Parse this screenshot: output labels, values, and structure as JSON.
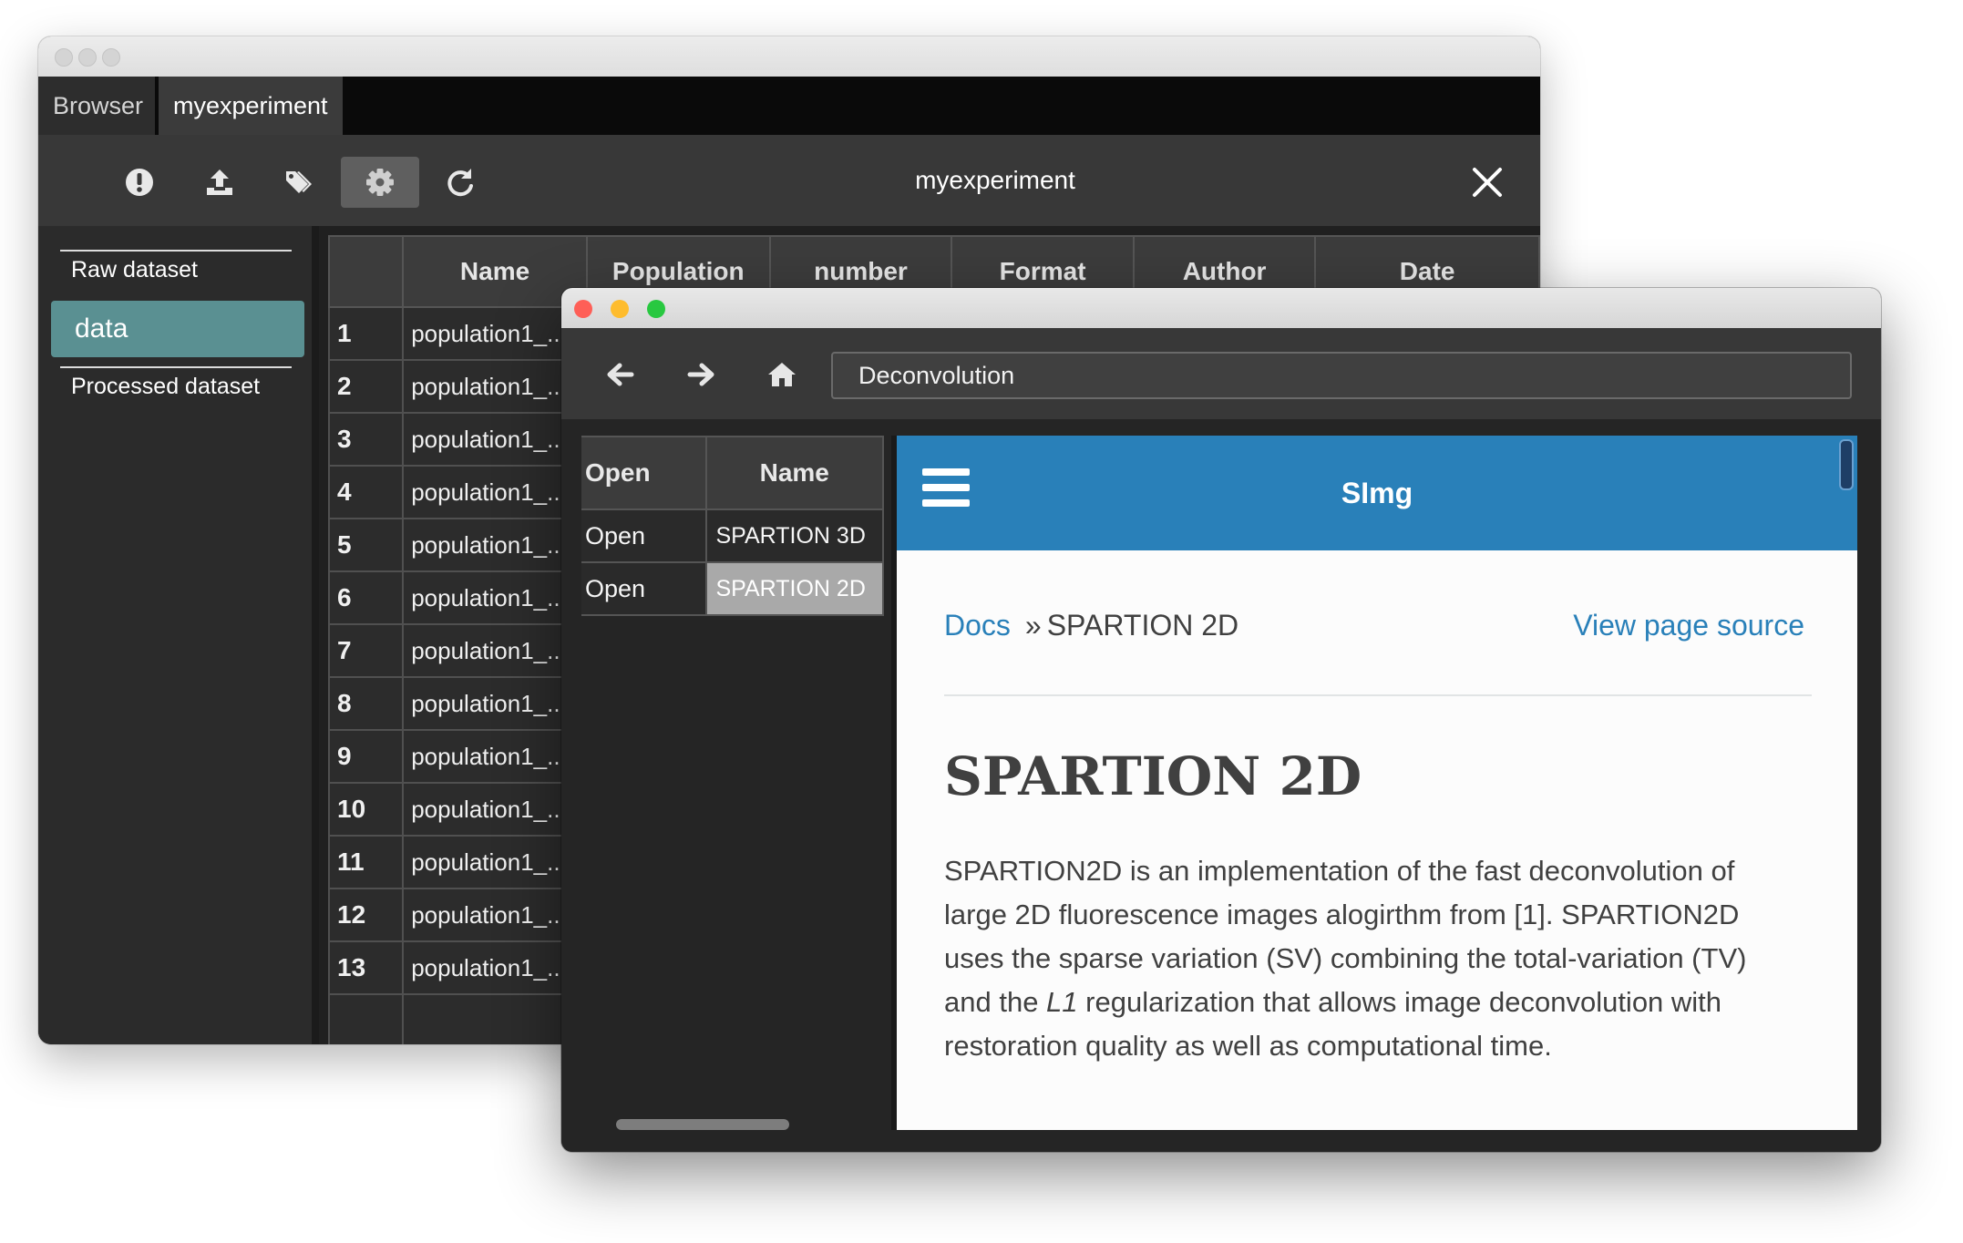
{
  "back_window": {
    "tabs": [
      "Browser",
      "myexperiment"
    ],
    "toolbar": {
      "title": "myexperiment",
      "icons": [
        "info-icon",
        "upload-icon",
        "tags-icon",
        "gear-icon",
        "refresh-icon",
        "close-icon"
      ]
    },
    "sidebar": {
      "raw_label": "Raw dataset",
      "selected_item": "data",
      "processed_label": "Processed dataset"
    },
    "table": {
      "columns": [
        "",
        "Name",
        "Population",
        "number",
        "Format",
        "Author",
        "Date"
      ],
      "rows": [
        {
          "idx": "1",
          "name": "population1_..."
        },
        {
          "idx": "2",
          "name": "population1_..."
        },
        {
          "idx": "3",
          "name": "population1_..."
        },
        {
          "idx": "4",
          "name": "population1_..."
        },
        {
          "idx": "5",
          "name": "population1_..."
        },
        {
          "idx": "6",
          "name": "population1_..."
        },
        {
          "idx": "7",
          "name": "population1_..."
        },
        {
          "idx": "8",
          "name": "population1_..."
        },
        {
          "idx": "9",
          "name": "population1_..."
        },
        {
          "idx": "10",
          "name": "population1_..."
        },
        {
          "idx": "11",
          "name": "population1_..."
        },
        {
          "idx": "12",
          "name": "population1_..."
        },
        {
          "idx": "13",
          "name": "population1_..."
        }
      ]
    }
  },
  "front_window": {
    "traffic_light_colors": [
      "#fe5f57",
      "#febc2e",
      "#28c840"
    ],
    "nav": {
      "icons": [
        "back-arrow-icon",
        "forward-arrow-icon",
        "home-icon"
      ],
      "url": "Deconvolution"
    },
    "tools_table": {
      "columns": [
        "Open",
        "Name"
      ],
      "rows": [
        {
          "open": "Open",
          "name": "SPARTION 3D",
          "selected": false
        },
        {
          "open": "Open",
          "name": "SPARTION 2D",
          "selected": true
        }
      ]
    },
    "doc": {
      "header_title": "SImg",
      "breadcrumb_root": "Docs",
      "breadcrumb_sep": "»",
      "breadcrumb_current": "SPARTION 2D",
      "view_source": "View page source",
      "heading": "SPARTION 2D",
      "paragraph_part1": "SPARTION2D is an implementation of the fast deconvolution of large 2D fluorescence images alogirthm from [1]. SPARTION2D uses the sparse variation (SV) combining the total-variation (TV) and the ",
      "paragraph_em": "L1",
      "paragraph_part2": " regularization that allows image deconvolution with restoration quality as well as computational time."
    },
    "colors": {
      "header_blue": "#2980b9",
      "selected_teal": "#5a9092"
    }
  }
}
